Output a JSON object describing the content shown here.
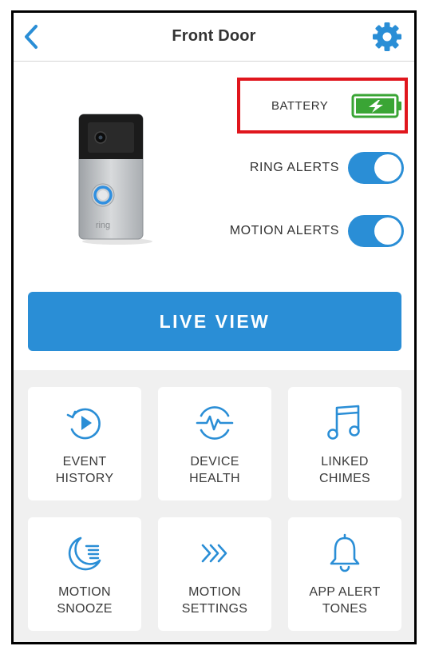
{
  "header": {
    "title": "Front Door",
    "back_icon": "chevron-left-icon",
    "settings_icon": "gear-icon"
  },
  "device": {
    "image": "ring-doorbell-image",
    "brand_text": "ring"
  },
  "battery": {
    "label": "BATTERY",
    "icon": "battery-charging-icon",
    "level": 1.0,
    "color": "#3aa535",
    "highlight_color": "#e0161d"
  },
  "alerts": {
    "ring": {
      "label": "RING ALERTS",
      "on": true
    },
    "motion": {
      "label": "MOTION ALERTS",
      "on": true
    }
  },
  "live_view": {
    "label": "LIVE VIEW"
  },
  "tiles": [
    {
      "line1": "EVENT",
      "line2": "HISTORY",
      "icon": "event-history-icon"
    },
    {
      "line1": "DEVICE",
      "line2": "HEALTH",
      "icon": "device-health-icon"
    },
    {
      "line1": "LINKED",
      "line2": "CHIMES",
      "icon": "music-note-icon"
    },
    {
      "line1": "MOTION",
      "line2": "SNOOZE",
      "icon": "motion-snooze-icon"
    },
    {
      "line1": "MOTION",
      "line2": "SETTINGS",
      "icon": "motion-settings-icon"
    },
    {
      "line1": "APP ALERT",
      "line2": "TONES",
      "icon": "bell-icon"
    }
  ],
  "colors": {
    "accent": "#2a8ed6",
    "text": "#333333",
    "grid_background": "#f0f0f0"
  }
}
